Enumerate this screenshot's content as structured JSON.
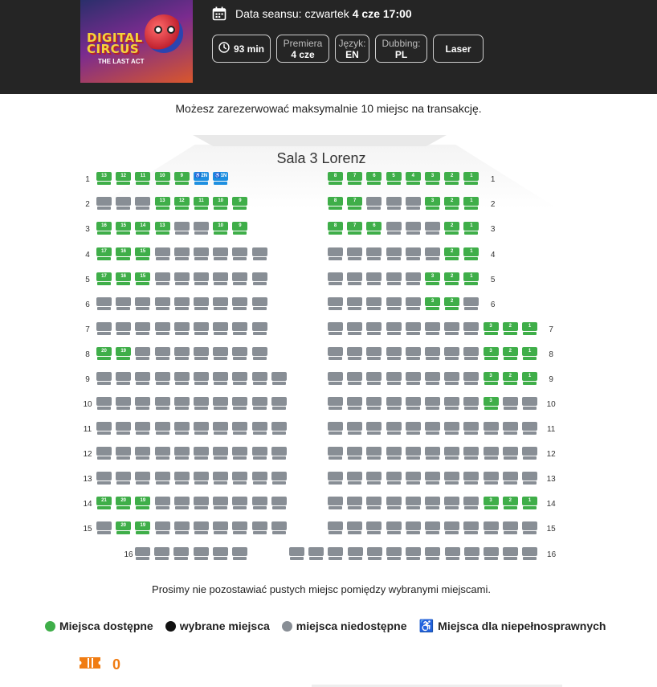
{
  "movie": {
    "poster_title_line1": "DIGITAL",
    "poster_title_line2": "CIRCUS",
    "poster_sub": "THE LAST ACT",
    "date_label": "Data seansu:",
    "date_value_prefix": "czwartek",
    "date_value": "4 cze 17:00",
    "chips": {
      "duration": "93 min",
      "premiere_key": "Premiera",
      "premiere_val": "4 cze",
      "language_key": "Język:",
      "language_val": "EN",
      "dubbing_key": "Dubbing:",
      "dubbing_val": "PL",
      "laser": "Laser"
    }
  },
  "notice": "Możesz zarezerwować maksymalnie 10 miejsc na transakcję.",
  "hall_name": "Sala 3 Lorenz",
  "hint": "Prosimy nie pozostawiać pustych miejsc pomiędzy wybranymi miejscami.",
  "legend": {
    "available": "Miejsca dostępne",
    "selected": "wybrane miejsca",
    "unavailable": "miejsca niedostępne",
    "disabled": "Miejsca dla niepełnosprawnych"
  },
  "colors": {
    "available": "#3fae49",
    "unavailable": "#888e95",
    "disabled": "#1e8fe0",
    "selected": "#111111",
    "accent": "#f07c12"
  },
  "ticket_count": "0",
  "seat_rows": [
    {
      "row": "1",
      "left": [
        "a13",
        "a12",
        "a11",
        "a10",
        "a9",
        "d2N",
        "d1N"
      ],
      "right": [
        "a8",
        "a7",
        "a6",
        "a5",
        "a4",
        "a3",
        "a2",
        "a1"
      ]
    },
    {
      "row": "2",
      "left": [
        "u",
        "u",
        "u",
        "a13",
        "a12",
        "a11",
        "a10",
        "a9"
      ],
      "right": [
        "a8",
        "a7",
        "u",
        "u",
        "u",
        "a3",
        "a2",
        "a1"
      ]
    },
    {
      "row": "3",
      "left": [
        "a16",
        "a15",
        "a14",
        "a13",
        "u",
        "u",
        "a10",
        "a9"
      ],
      "right": [
        "a8",
        "a7",
        "a6",
        "u",
        "u",
        "u",
        "a2",
        "a1"
      ]
    },
    {
      "row": "4",
      "left": [
        "a17",
        "a16",
        "a15",
        "u",
        "u",
        "u",
        "u",
        "u",
        "u"
      ],
      "right": [
        "u",
        "u",
        "u",
        "u",
        "u",
        "u",
        "a2",
        "a1"
      ]
    },
    {
      "row": "5",
      "left": [
        "a17",
        "a16",
        "a15",
        "u",
        "u",
        "u",
        "u",
        "u",
        "u"
      ],
      "right": [
        "u",
        "u",
        "u",
        "u",
        "u",
        "a3",
        "a2",
        "a1"
      ]
    },
    {
      "row": "6",
      "left": [
        "u",
        "u",
        "u",
        "u",
        "u",
        "u",
        "u",
        "u",
        "u"
      ],
      "right": [
        "u",
        "u",
        "u",
        "u",
        "u",
        "a3",
        "a2",
        "u"
      ]
    },
    {
      "row": "7",
      "left": [
        "u",
        "u",
        "u",
        "u",
        "u",
        "u",
        "u",
        "u",
        "u"
      ],
      "right": [
        "u",
        "u",
        "u",
        "u",
        "u",
        "u",
        "u",
        "u",
        "a3",
        "a2",
        "a1"
      ]
    },
    {
      "row": "8",
      "left": [
        "a20",
        "a19",
        "u",
        "u",
        "u",
        "u",
        "u",
        "u",
        "u"
      ],
      "right": [
        "u",
        "u",
        "u",
        "u",
        "u",
        "u",
        "u",
        "u",
        "a3",
        "a2",
        "a1"
      ]
    },
    {
      "row": "9",
      "left": [
        "u",
        "u",
        "u",
        "u",
        "u",
        "u",
        "u",
        "u",
        "u",
        "u"
      ],
      "right": [
        "u",
        "u",
        "u",
        "u",
        "u",
        "u",
        "u",
        "u",
        "a3",
        "a2",
        "a1"
      ]
    },
    {
      "row": "10",
      "left": [
        "u",
        "u",
        "u",
        "u",
        "u",
        "u",
        "u",
        "u",
        "u",
        "u"
      ],
      "right": [
        "u",
        "u",
        "u",
        "u",
        "u",
        "u",
        "u",
        "u",
        "a3",
        "u",
        "u"
      ]
    },
    {
      "row": "11",
      "left": [
        "u",
        "u",
        "u",
        "u",
        "u",
        "u",
        "u",
        "u",
        "u",
        "u"
      ],
      "right": [
        "u",
        "u",
        "u",
        "u",
        "u",
        "u",
        "u",
        "u",
        "u",
        "u",
        "u"
      ]
    },
    {
      "row": "12",
      "left": [
        "u",
        "u",
        "u",
        "u",
        "u",
        "u",
        "u",
        "u",
        "u",
        "u"
      ],
      "right": [
        "u",
        "u",
        "u",
        "u",
        "u",
        "u",
        "u",
        "u",
        "u",
        "u",
        "u"
      ]
    },
    {
      "row": "13",
      "left": [
        "u",
        "u",
        "u",
        "u",
        "u",
        "u",
        "u",
        "u",
        "u",
        "u"
      ],
      "right": [
        "u",
        "u",
        "u",
        "u",
        "u",
        "u",
        "u",
        "u",
        "u",
        "u",
        "u"
      ]
    },
    {
      "row": "14",
      "left": [
        "a21",
        "a20",
        "a19",
        "u",
        "u",
        "u",
        "u",
        "u",
        "u",
        "u"
      ],
      "right": [
        "u",
        "u",
        "u",
        "u",
        "u",
        "u",
        "u",
        "u",
        "a3",
        "a2",
        "a1"
      ]
    },
    {
      "row": "15",
      "left": [
        "u",
        "a20",
        "a19",
        "u",
        "u",
        "u",
        "u",
        "u",
        "u",
        "u"
      ],
      "right": [
        "u",
        "u",
        "u",
        "u",
        "u",
        "u",
        "u",
        "u",
        "u",
        "u",
        "u"
      ]
    },
    {
      "row": "16",
      "left": [
        "u",
        "u",
        "u",
        "u",
        "u",
        "u"
      ],
      "right": [
        "u",
        "u",
        "u",
        "u",
        "u",
        "u",
        "u",
        "u",
        "u",
        "u",
        "u",
        "u",
        "u"
      ]
    }
  ]
}
